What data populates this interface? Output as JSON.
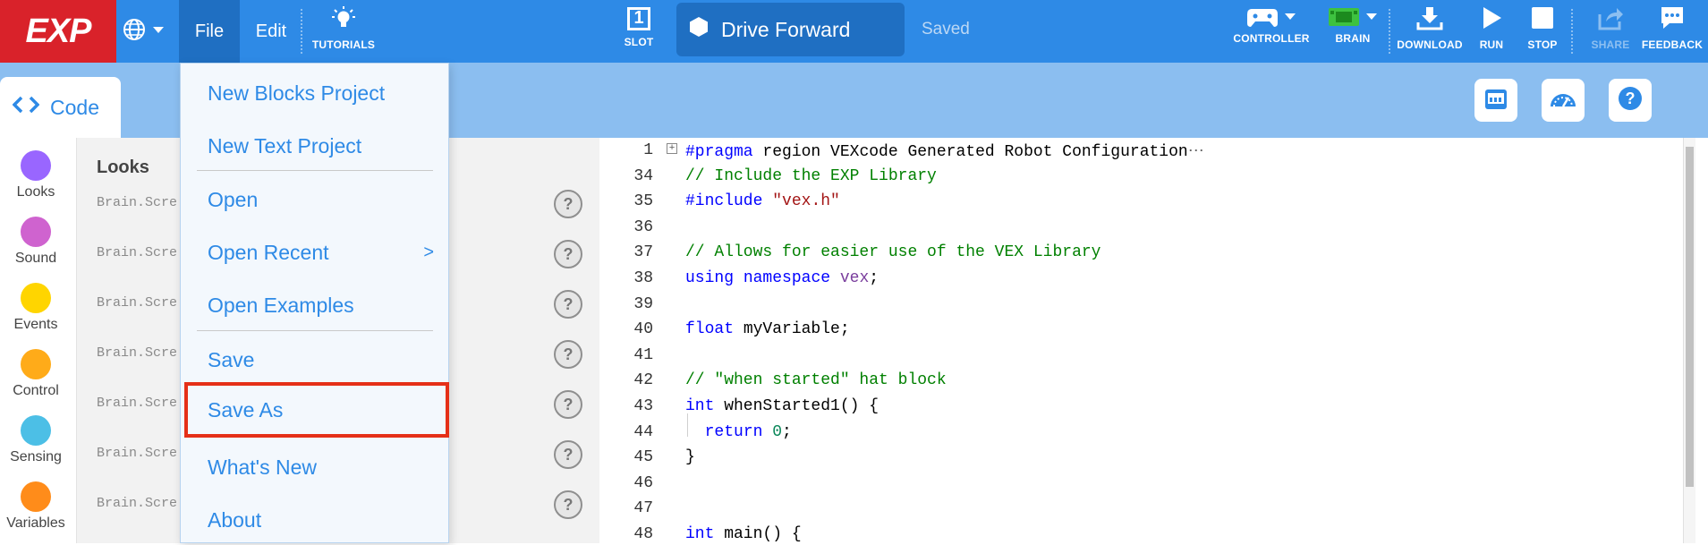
{
  "topbar": {
    "logo": "EXP",
    "menu_file": "File",
    "menu_edit": "Edit",
    "tutorials": "TUTORIALS",
    "slot_label": "SLOT",
    "slot_number": "1",
    "project_name": "Drive Forward",
    "save_status": "Saved",
    "controller": "CONTROLLER",
    "brain": "BRAIN",
    "download": "DOWNLOAD",
    "run": "RUN",
    "stop": "STOP",
    "share": "SHARE",
    "feedback": "FEEDBACK"
  },
  "code_tab": {
    "label": "Code"
  },
  "categories": [
    {
      "name": "Looks",
      "color": "#9966ff"
    },
    {
      "name": "Sound",
      "color": "#cf63cf"
    },
    {
      "name": "Events",
      "color": "#ffd500"
    },
    {
      "name": "Control",
      "color": "#ffab19"
    },
    {
      "name": "Sensing",
      "color": "#4cbfe6"
    },
    {
      "name": "Variables",
      "color": "#ff8c1a"
    }
  ],
  "palette": {
    "title": "Looks",
    "items": [
      "Brain.Scre",
      "Brain.Scre",
      "Brain.Scre",
      "Brain.Scre",
      "Brain.Scre",
      "Brain.Scre",
      "Brain.Scre"
    ],
    "help": "?"
  },
  "file_menu": {
    "items": [
      {
        "label": "New Blocks Project"
      },
      {
        "label": "New Text Project"
      },
      {
        "label": "Open"
      },
      {
        "label": "Open Recent",
        "arrow": ">"
      },
      {
        "label": "Open Examples"
      },
      {
        "label": "Save"
      },
      {
        "label": "Save As"
      },
      {
        "label": "What's New"
      },
      {
        "label": "About"
      }
    ]
  },
  "editor": {
    "line_numbers": [
      "1",
      "34",
      "35",
      "36",
      "37",
      "38",
      "39",
      "40",
      "41",
      "42",
      "43",
      "44",
      "45",
      "46",
      "47",
      "48"
    ],
    "lines": [
      {
        "html": "<span class=\"pp\">#pragma</span> region VEXcode Generated Robot Configuration<span style=\"color:#666\">⋯</span>"
      },
      {
        "html": "<span class=\"cm\">// Include the EXP Library</span>"
      },
      {
        "html": "<span class=\"pp\">#include</span> <span class=\"str\">\"vex.h\"</span>"
      },
      {
        "html": ""
      },
      {
        "html": "<span class=\"cm\">// Allows for easier use of the VEX Library</span>"
      },
      {
        "html": "<span class=\"kw\">using</span> <span class=\"kw\">namespace</span> <span class=\"ns\">vex</span>;"
      },
      {
        "html": ""
      },
      {
        "html": "<span class=\"kw\">float</span> myVariable;"
      },
      {
        "html": ""
      },
      {
        "html": "<span class=\"cm\">// \"when started\" hat block</span>"
      },
      {
        "html": "<span class=\"kw\">int</span> whenStarted1() {"
      },
      {
        "html": "  <span class=\"kw\">return</span> <span class=\"num\">0</span>;"
      },
      {
        "html": "}"
      },
      {
        "html": ""
      },
      {
        "html": ""
      },
      {
        "html": "<span class=\"kw\">int</span> main() {"
      }
    ]
  }
}
